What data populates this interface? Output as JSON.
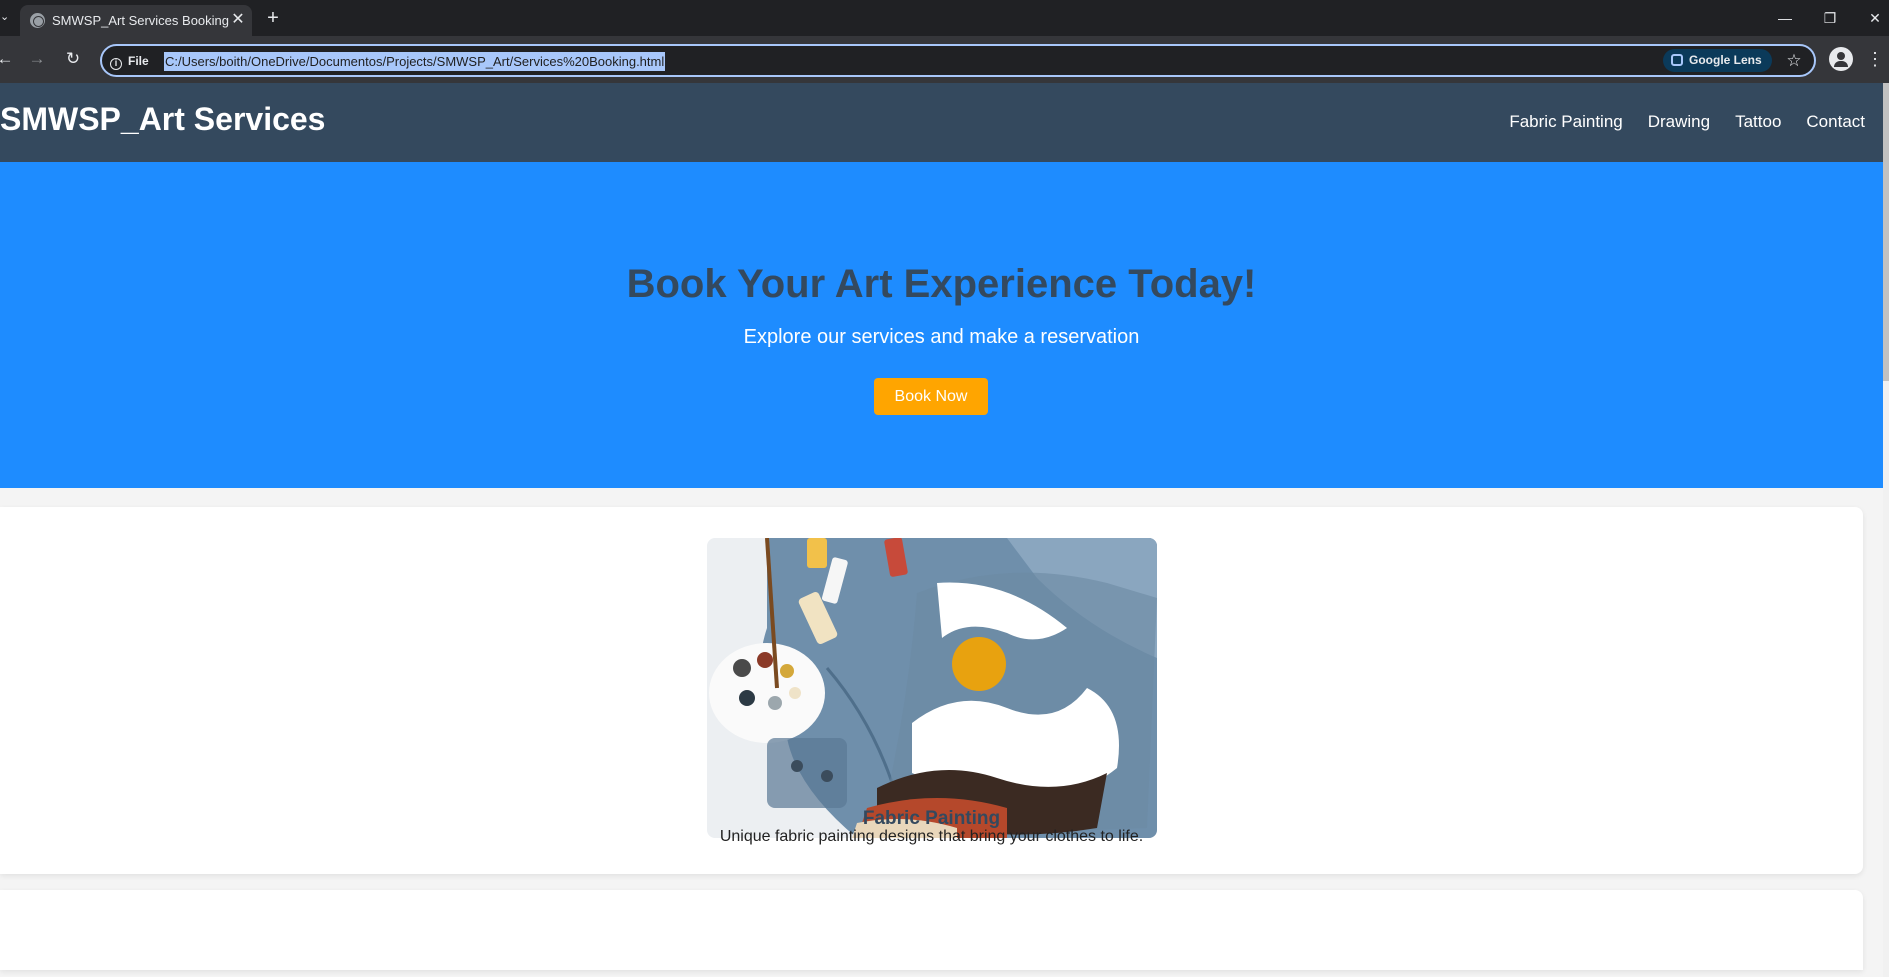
{
  "browser": {
    "tab_title": "SMWSP_Art Services Booking",
    "site_info_label": "File",
    "url": "C:/Users/boith/OneDrive/Documentos/Projects/SMWSP_Art/Services%20Booking.html",
    "lens_label": "Google Lens"
  },
  "site": {
    "brand": "SMWSP_Art Services",
    "nav": [
      "Fabric Painting",
      "Drawing",
      "Tattoo",
      "Contact"
    ]
  },
  "hero": {
    "title": "Book Your Art Experience Today!",
    "subtitle": "Explore our services and make a reservation",
    "button": "Book Now"
  },
  "services": [
    {
      "title": "Fabric Painting",
      "description": "Unique fabric painting designs that bring your clothes to life."
    }
  ],
  "colors": {
    "header_bg": "#34495e",
    "hero_bg": "#1e8cff",
    "button_bg": "#ffa500"
  }
}
